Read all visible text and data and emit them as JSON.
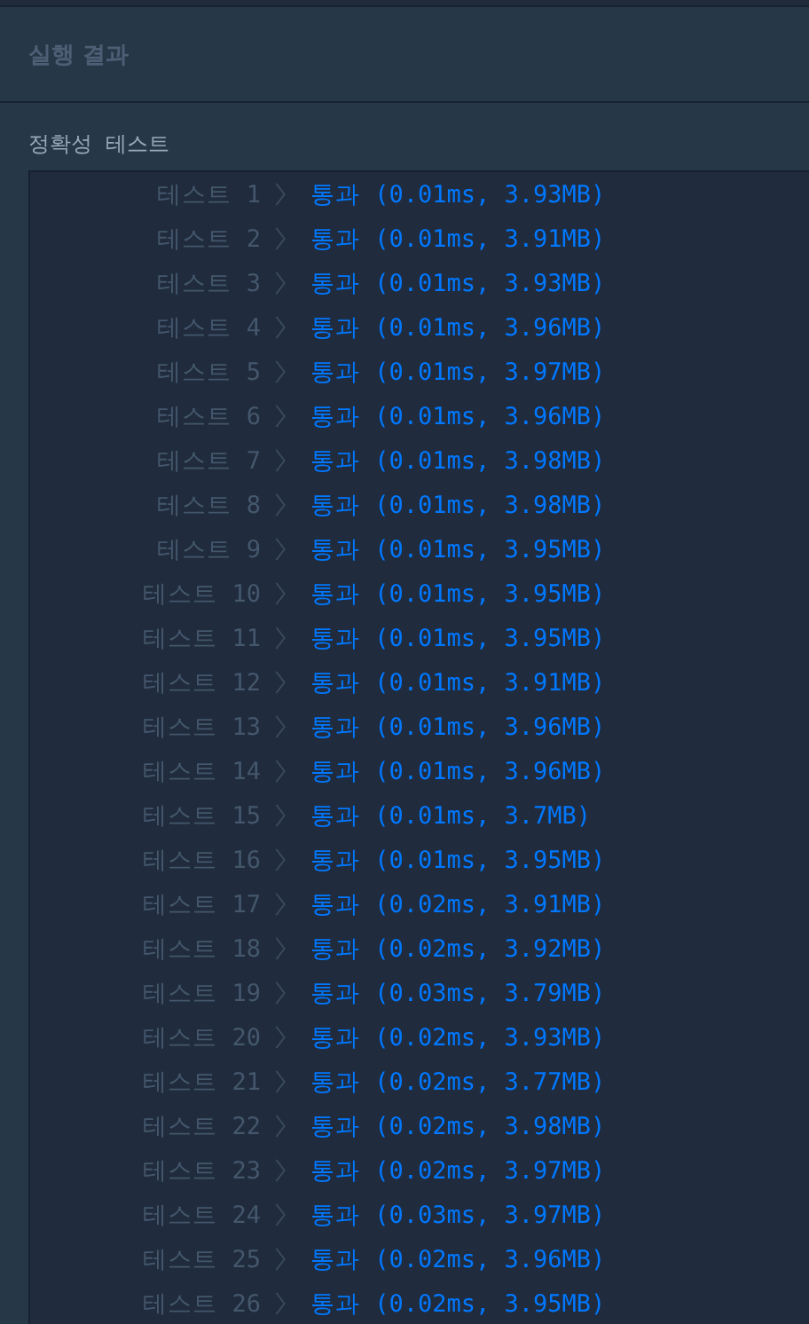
{
  "panel": {
    "title": "실행 결과"
  },
  "section": {
    "heading": "정확성  테스트"
  },
  "results": [
    {
      "label": "테스트 1",
      "status": "통과",
      "detail": "(0.01ms, 3.93MB)"
    },
    {
      "label": "테스트 2",
      "status": "통과",
      "detail": "(0.01ms, 3.91MB)"
    },
    {
      "label": "테스트 3",
      "status": "통과",
      "detail": "(0.01ms, 3.93MB)"
    },
    {
      "label": "테스트 4",
      "status": "통과",
      "detail": "(0.01ms, 3.96MB)"
    },
    {
      "label": "테스트 5",
      "status": "통과",
      "detail": "(0.01ms, 3.97MB)"
    },
    {
      "label": "테스트 6",
      "status": "통과",
      "detail": "(0.01ms, 3.96MB)"
    },
    {
      "label": "테스트 7",
      "status": "통과",
      "detail": "(0.01ms, 3.98MB)"
    },
    {
      "label": "테스트 8",
      "status": "통과",
      "detail": "(0.01ms, 3.98MB)"
    },
    {
      "label": "테스트 9",
      "status": "통과",
      "detail": "(0.01ms, 3.95MB)"
    },
    {
      "label": "테스트 10",
      "status": "통과",
      "detail": "(0.01ms, 3.95MB)"
    },
    {
      "label": "테스트 11",
      "status": "통과",
      "detail": "(0.01ms, 3.95MB)"
    },
    {
      "label": "테스트 12",
      "status": "통과",
      "detail": "(0.01ms, 3.91MB)"
    },
    {
      "label": "테스트 13",
      "status": "통과",
      "detail": "(0.01ms, 3.96MB)"
    },
    {
      "label": "테스트 14",
      "status": "통과",
      "detail": "(0.01ms, 3.96MB)"
    },
    {
      "label": "테스트 15",
      "status": "통과",
      "detail": "(0.01ms, 3.7MB)"
    },
    {
      "label": "테스트 16",
      "status": "통과",
      "detail": "(0.01ms, 3.95MB)"
    },
    {
      "label": "테스트 17",
      "status": "통과",
      "detail": "(0.02ms, 3.91MB)"
    },
    {
      "label": "테스트 18",
      "status": "통과",
      "detail": "(0.02ms, 3.92MB)"
    },
    {
      "label": "테스트 19",
      "status": "통과",
      "detail": "(0.03ms, 3.79MB)"
    },
    {
      "label": "테스트 20",
      "status": "통과",
      "detail": "(0.02ms, 3.93MB)"
    },
    {
      "label": "테스트 21",
      "status": "통과",
      "detail": "(0.02ms, 3.77MB)"
    },
    {
      "label": "테스트 22",
      "status": "통과",
      "detail": "(0.02ms, 3.98MB)"
    },
    {
      "label": "테스트 23",
      "status": "통과",
      "detail": "(0.02ms, 3.97MB)"
    },
    {
      "label": "테스트 24",
      "status": "통과",
      "detail": "(0.03ms, 3.97MB)"
    },
    {
      "label": "테스트 25",
      "status": "통과",
      "detail": "(0.02ms, 3.96MB)"
    },
    {
      "label": "테스트 26",
      "status": "통과",
      "detail": "(0.02ms, 3.95MB)"
    }
  ]
}
